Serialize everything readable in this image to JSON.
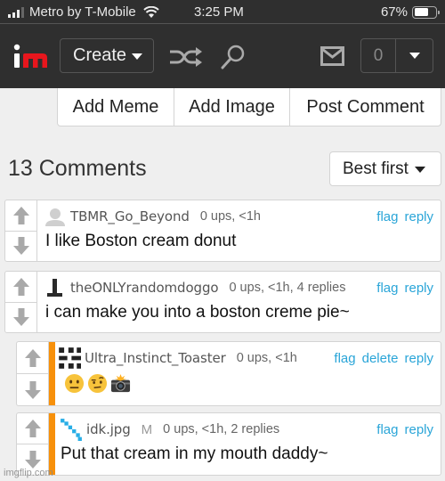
{
  "status_bar": {
    "carrier": "Metro by T-Mobile",
    "time": "3:25 PM",
    "battery_percent": "67%",
    "battery_level": 0.67,
    "signal_bars": 3
  },
  "header": {
    "logo_text": "im",
    "create_label": "Create",
    "icons": [
      "shuffle-icon",
      "search-icon",
      "mail-icon"
    ],
    "notification_count": "0"
  },
  "actions": {
    "add_meme": "Add Meme",
    "add_image": "Add Image",
    "post_comment": "Post Comment"
  },
  "comments_header": {
    "title": "13 Comments",
    "sort_selected": "Best first"
  },
  "comments": [
    {
      "username": "TBMR_Go_Beyond",
      "meta": "0 ups, <1h",
      "links": [
        "flag",
        "reply"
      ],
      "text": "I like Boston cream donut",
      "avatar": "default-avatar",
      "is_reply": false
    },
    {
      "username": "theONLYrandomdoggo",
      "meta": "0 ups, <1h, 4 replies",
      "links": [
        "flag",
        "reply"
      ],
      "text": "i can make you into a boston creme pie~",
      "avatar": "t-shape-avatar",
      "is_reply": false
    },
    {
      "username": "Ultra_Instinct_Toaster",
      "meta": "0 ups, <1h",
      "links": [
        "flag",
        "delete",
        "reply"
      ],
      "text": "",
      "emojis": [
        "neutral-face",
        "face-with-raised-eyebrow",
        "camera-with-flash"
      ],
      "avatar": "checker-avatar",
      "is_reply": true
    },
    {
      "username": "idk.jpg",
      "badge": "M",
      "meta": "0 ups, <1h, 2 replies",
      "links": [
        "flag",
        "reply"
      ],
      "text": "Put that cream in my mouth daddy~",
      "avatar": "diagonal-avatar",
      "is_reply": true
    }
  ],
  "watermark": "imgflip.com",
  "colors": {
    "header_bg": "#2f2f2f",
    "logo_red": "#e8161d",
    "link_blue": "#2aa5d8",
    "reply_bar_orange": "#f7900a",
    "page_bg": "#efefef"
  }
}
